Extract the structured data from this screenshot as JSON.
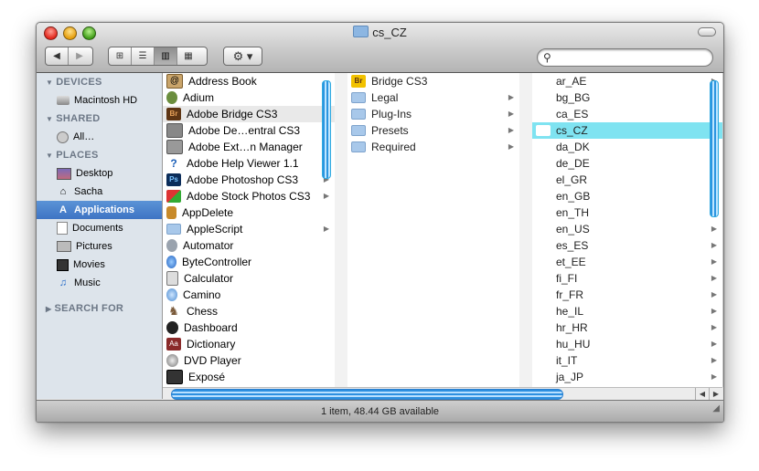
{
  "window": {
    "title": "cs_CZ",
    "status": "1 item, 48.44 GB available"
  },
  "toolbar": {
    "back_glyph": "◀",
    "forward_glyph": "▶",
    "view_glyphs": [
      "⊞",
      "☰",
      "▥",
      "▦"
    ],
    "action_glyph": "⚙ ▾",
    "search_placeholder": ""
  },
  "sidebar": {
    "sections": {
      "devices": "DEVICES",
      "shared": "SHARED",
      "places": "PLACES",
      "search_for": "SEARCH FOR"
    },
    "devices": [
      {
        "label": "Macintosh HD",
        "icon": "hard-drive-icon"
      }
    ],
    "shared": [
      {
        "label": "All…",
        "icon": "network-icon"
      }
    ],
    "places": [
      {
        "label": "Desktop",
        "icon": "desktop-icon"
      },
      {
        "label": "Sacha",
        "icon": "home-icon"
      },
      {
        "label": "Applications",
        "icon": "applications-icon",
        "selected": true
      },
      {
        "label": "Documents",
        "icon": "documents-icon"
      },
      {
        "label": "Pictures",
        "icon": "pictures-icon"
      },
      {
        "label": "Movies",
        "icon": "movies-icon"
      },
      {
        "label": "Music",
        "icon": "music-icon"
      }
    ]
  },
  "columns": {
    "applications": [
      {
        "label": "Address Book",
        "icon": "address-book-icon"
      },
      {
        "label": "Adium",
        "icon": "adium-icon"
      },
      {
        "label": "Adobe Bridge CS3",
        "icon": "adobe-bridge-icon",
        "highlight": true
      },
      {
        "label": "Adobe De…entral CS3",
        "icon": "adobe-device-central-icon",
        "arrow": true
      },
      {
        "label": "Adobe Ext…n Manager",
        "icon": "adobe-extension-manager-icon",
        "arrow": true
      },
      {
        "label": "Adobe Help Viewer 1.1",
        "icon": "help-icon"
      },
      {
        "label": "Adobe Photoshop CS3",
        "icon": "photoshop-icon",
        "arrow": true
      },
      {
        "label": "Adobe Stock Photos CS3",
        "icon": "stock-photos-icon",
        "arrow": true
      },
      {
        "label": "AppDelete",
        "icon": "appdelete-icon"
      },
      {
        "label": "AppleScript",
        "icon": "folder-icon",
        "arrow": true
      },
      {
        "label": "Automator",
        "icon": "automator-icon"
      },
      {
        "label": "ByteController",
        "icon": "bytecontroller-icon"
      },
      {
        "label": "Calculator",
        "icon": "calculator-icon"
      },
      {
        "label": "Camino",
        "icon": "camino-icon"
      },
      {
        "label": "Chess",
        "icon": "chess-icon"
      },
      {
        "label": "Dashboard",
        "icon": "dashboard-icon"
      },
      {
        "label": "Dictionary",
        "icon": "dictionary-icon"
      },
      {
        "label": "DVD Player",
        "icon": "dvd-player-icon"
      },
      {
        "label": "Exposé",
        "icon": "expose-icon"
      }
    ],
    "bridge": [
      {
        "label": "Bridge CS3",
        "icon": "bridge-app-icon"
      },
      {
        "label": "Legal",
        "icon": "folder-icon",
        "arrow": true
      },
      {
        "label": "Plug-Ins",
        "icon": "folder-icon",
        "arrow": true
      },
      {
        "label": "Presets",
        "icon": "folder-icon",
        "arrow": true
      },
      {
        "label": "Required",
        "icon": "folder-icon",
        "arrow": true
      }
    ],
    "locales": [
      {
        "label": "ar_AE"
      },
      {
        "label": "bg_BG"
      },
      {
        "label": "ca_ES"
      },
      {
        "label": "cs_CZ",
        "selected": true
      },
      {
        "label": "da_DK"
      },
      {
        "label": "de_DE"
      },
      {
        "label": "el_GR"
      },
      {
        "label": "en_GB"
      },
      {
        "label": "en_TH"
      },
      {
        "label": "en_US"
      },
      {
        "label": "es_ES"
      },
      {
        "label": "et_EE"
      },
      {
        "label": "fi_FI"
      },
      {
        "label": "fr_FR"
      },
      {
        "label": "he_IL"
      },
      {
        "label": "hr_HR"
      },
      {
        "label": "hu_HU"
      },
      {
        "label": "it_IT"
      },
      {
        "label": "ja_JP"
      }
    ]
  },
  "colors": {
    "selection": "#3e74c4",
    "column_selection": "#7fe3f1",
    "scroll_thumb": "#2d8fe0"
  }
}
